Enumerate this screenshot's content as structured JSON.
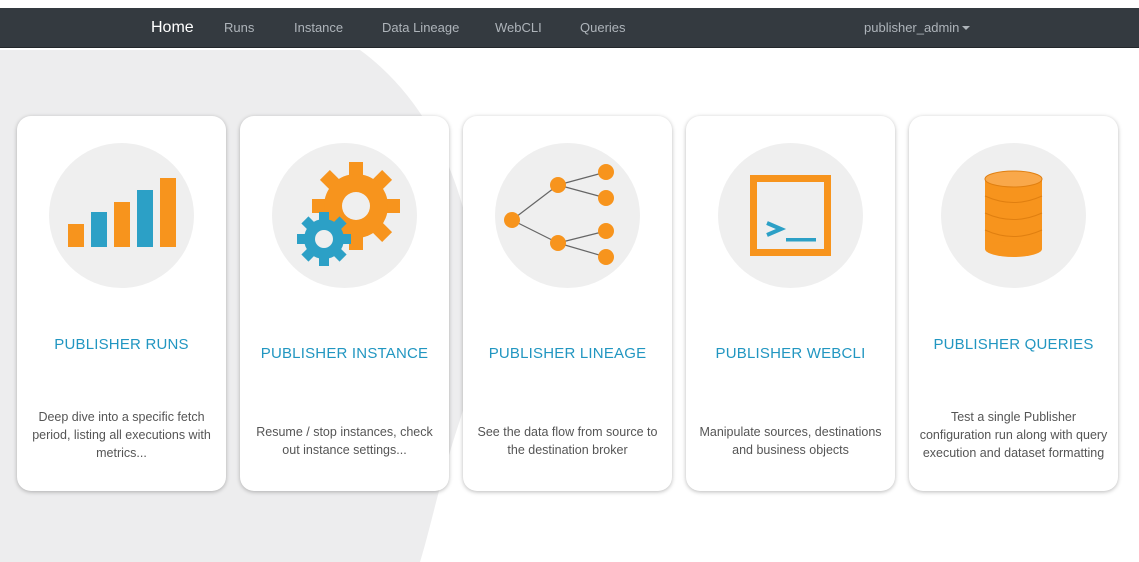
{
  "navbar": {
    "brand": "Home",
    "items": [
      "Runs",
      "Instance",
      "Data Lineage",
      "WebCLI",
      "Queries"
    ],
    "user": "publisher_admin"
  },
  "cards": [
    {
      "title": "PUBLISHER RUNS",
      "description": "Deep dive into a specific fetch period, listing all executions with metrics...",
      "icon": "bar-chart-icon"
    },
    {
      "title": "PUBLISHER INSTANCE",
      "description": "Resume / stop instances, check out instance settings...",
      "icon": "gears-icon"
    },
    {
      "title": "PUBLISHER LINEAGE",
      "description": "See the data flow from source to the destination broker",
      "icon": "network-tree-icon"
    },
    {
      "title": "PUBLISHER WEBCLI",
      "description": "Manipulate sources, destinations and business objects",
      "icon": "terminal-icon"
    },
    {
      "title": "PUBLISHER QUERIES",
      "description": "Test a single Publisher configuration run along with query execution and dataset formatting",
      "icon": "database-icon"
    }
  ],
  "colors": {
    "navbar_bg": "#343a40",
    "accent_blue": "#2196c1",
    "icon_orange": "#f7941d",
    "icon_teal": "#2ca0c6"
  }
}
